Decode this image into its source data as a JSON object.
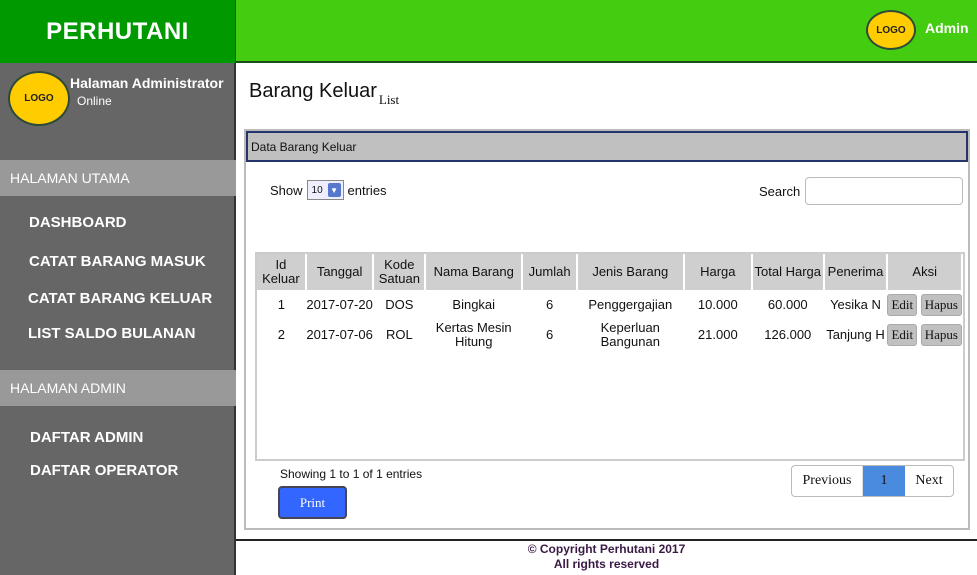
{
  "brand": "PERHUTANI",
  "header": {
    "logo_text": "LOGO",
    "user": "Admin"
  },
  "sidebar": {
    "logo_text": "LOGO",
    "title": "Halaman Administrator",
    "status": "Online",
    "sections": [
      {
        "label": "HALAMAN UTAMA",
        "items": [
          "DASHBOARD",
          "CATAT BARANG MASUK",
          "CATAT BARANG KELUAR",
          "LIST SALDO BULANAN"
        ]
      },
      {
        "label": "HALAMAN ADMIN",
        "items": [
          "DAFTAR ADMIN",
          "DAFTAR OPERATOR"
        ]
      }
    ]
  },
  "page": {
    "title": "Barang Keluar",
    "subtitle": "List"
  },
  "panel": {
    "title": "Data Barang Keluar",
    "show_label": "Show",
    "entries_value": "10",
    "entries_label": "entries",
    "search_label": "Search",
    "search_value": "",
    "columns": [
      "Id Keluar",
      "Tanggal",
      "Kode Satuan",
      "Nama Barang",
      "Jumlah",
      "Jenis Barang",
      "Harga",
      "Total Harga",
      "Penerima",
      "Aksi"
    ],
    "rows": [
      {
        "id": "1",
        "tanggal": "2017-07-20",
        "kode": "DOS",
        "nama": "Bingkai",
        "jumlah": "6",
        "jenis": "Penggergajian",
        "harga": "10.000",
        "total": "60.000",
        "penerima": "Yesika N"
      },
      {
        "id": "2",
        "tanggal": "2017-07-06",
        "kode": "ROL",
        "nama": "Kertas Mesin Hitung",
        "jumlah": "6",
        "jenis": "Keperluan Bangunan",
        "harga": "21.000",
        "total": "126.000",
        "penerima": "Tanjung H"
      }
    ],
    "edit_label": "Edit",
    "delete_label": "Hapus",
    "info": "Showing 1 to 1 of 1 entries",
    "print_label": "Print",
    "pagination": {
      "prev": "Previous",
      "current": "1",
      "next": "Next"
    }
  },
  "footer": {
    "line1": "© Copyright Perhutani 2017",
    "line2": "All rights reserved"
  },
  "colors": {
    "brand_green": "#009900",
    "topbar_green": "#44cc11",
    "sidebar_gray": "#666666",
    "logo_yellow": "#ffcc00",
    "print_blue": "#3366ff",
    "page_active": "#4a8be0"
  }
}
